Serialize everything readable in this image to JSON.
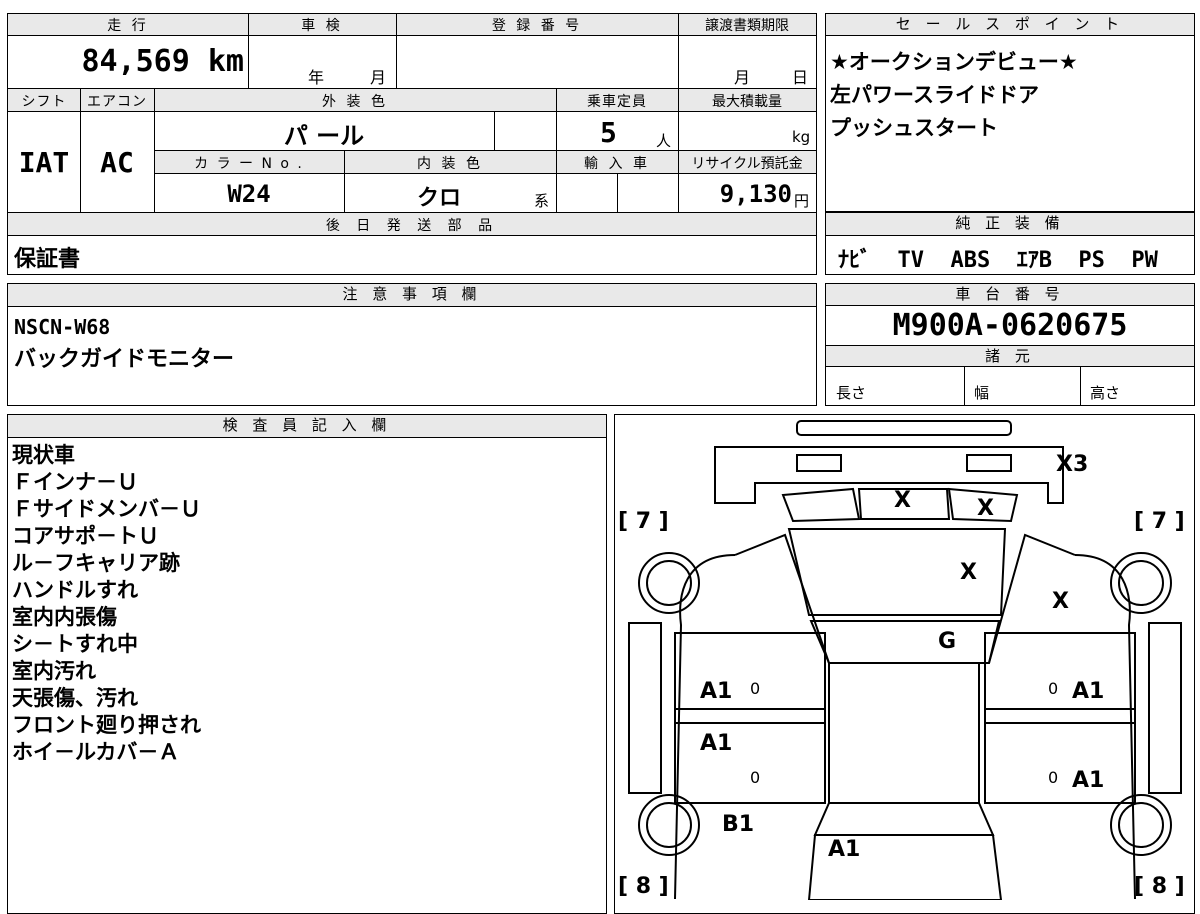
{
  "top_table": {
    "mileage_label": "走 行",
    "mileage_value": "84,569 km",
    "inspection_label": "車 検",
    "inspection_year": "年",
    "inspection_month": "月",
    "registration_label": "登 録 番 号",
    "transfer_label": "譲渡書類期限",
    "transfer_month": "月",
    "transfer_day": "日",
    "shift_label": "シフト",
    "shift_value": "IAT",
    "ac_label": "エアコン",
    "ac_value": "AC",
    "exterior_color_label": "外 装 色",
    "exterior_color_value": "パ ール",
    "capacity_label": "乗車定員",
    "capacity_value": "5",
    "capacity_unit": "人",
    "max_load_label": "最大積載量",
    "max_load_unit": "kg",
    "color_no_label": "カ ラ ー N o .",
    "color_no_value": "W24",
    "interior_color_label": "内 装 色",
    "interior_color_value": "クロ",
    "interior_color_suffix": "系",
    "import_label": "輸 入 車",
    "recycle_label": "リサイクル預託金",
    "recycle_value": "9,130",
    "recycle_unit": "円",
    "later_parts_label": "後 日 発 送 部 品",
    "later_parts_value": "保証書"
  },
  "sales_points": {
    "label": "セ ー ル ス ポ イ ン ト",
    "lines": [
      "★オークションデビュー★",
      "左パワースライドドア",
      "プッシュスタート"
    ]
  },
  "genuine_equipment": {
    "label": "純 正 装 備",
    "value": "ﾅﾋﾞ  TV  ABS  ｴｱB  PS  PW"
  },
  "notes": {
    "label": "注 意 事 項 欄",
    "lines": [
      "NSCN-W68",
      "バックガイドモニター"
    ]
  },
  "chassis": {
    "label": "車 台 番 号",
    "value": "M900A-0620675",
    "specs_label": "諸 元",
    "length_label": "長さ",
    "width_label": "幅",
    "height_label": "高さ"
  },
  "inspector": {
    "label": "検 査 員 記 入 欄",
    "lines": [
      "現状車",
      "Ｆインナ－Ｕ",
      "Ｆサイドメンバ－Ｕ",
      "コアサポ－トＵ",
      "ル－フキャリア跡",
      "ハンドルすれ",
      "室内内張傷",
      "シ－トすれ中",
      "室内汚れ",
      "天張傷、汚れ",
      "フロント廻り押され",
      "ホイ－ルカバ－Ａ"
    ]
  },
  "diagram": {
    "marks": {
      "roof": "X3",
      "windshield_left": "X",
      "windshield_right": "X",
      "hood": "X",
      "right_fender": "X",
      "front_glass": "G",
      "left_front_door": "A1",
      "right_front_door": "A1",
      "left_rear_door": "A1",
      "right_rear_door": "A1",
      "left_rear_quarter": "B1",
      "rear_panel": "A1",
      "zero_lf": "0",
      "zero_rf": "0",
      "zero_lr": "0",
      "zero_rr": "0"
    },
    "tire_front_left": "[ 7 ]",
    "tire_front_right": "[ 7 ]",
    "tire_rear_left": "[ 8 ]",
    "tire_rear_right": "[ 8 ]"
  }
}
